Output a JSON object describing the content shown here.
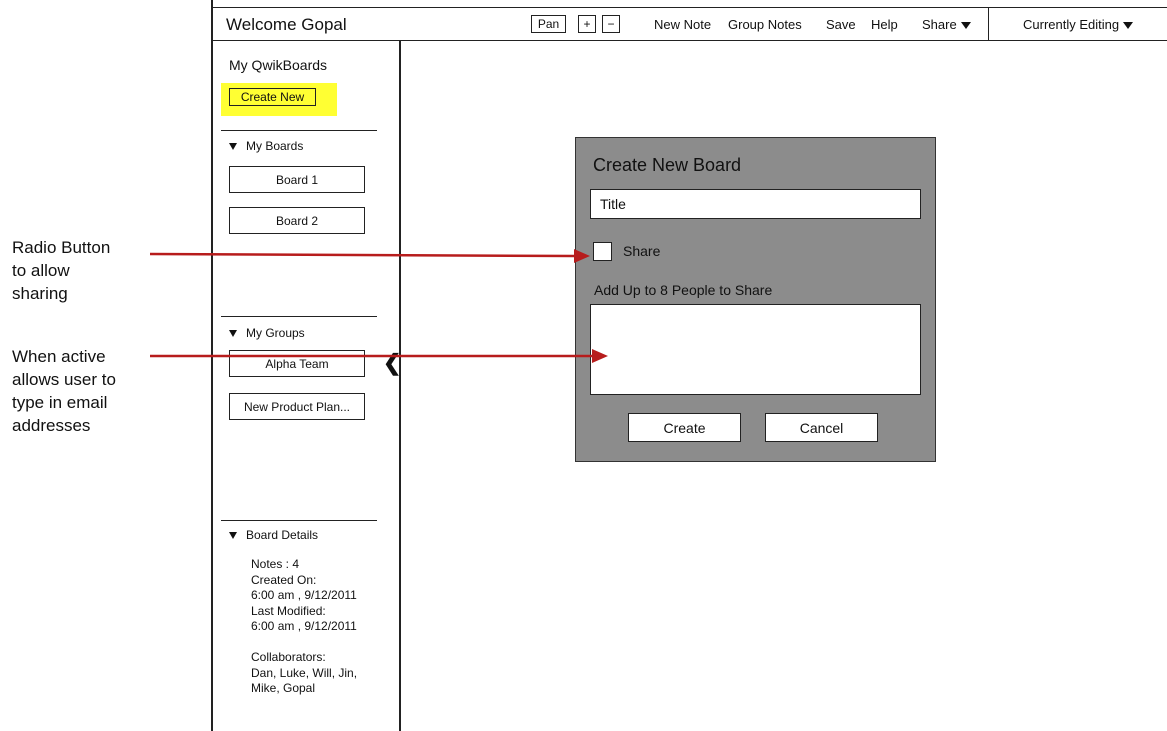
{
  "header": {
    "welcome": "Welcome Gopal",
    "pan_label": "Pan",
    "zoom_in_label": "+",
    "zoom_out_label": "−",
    "menu": {
      "new_note": "New Note",
      "group_notes": "Group Notes",
      "save": "Save",
      "help": "Help",
      "share": "Share",
      "currently_editing": "Currently Editing"
    }
  },
  "sidebar": {
    "title": "My QwikBoards",
    "create_new": "Create New",
    "my_boards": {
      "heading": "My Boards",
      "items": [
        "Board 1",
        "Board 2"
      ]
    },
    "my_groups": {
      "heading": "My Groups",
      "items": [
        "Alpha Team",
        "New Product Plan..."
      ]
    },
    "board_details": {
      "heading": "Board Details",
      "lines": [
        "Notes : 4",
        "Created On:",
        "6:00 am , 9/12/2011",
        "Last Modified:",
        "6:00 am , 9/12/2011",
        "",
        "Collaborators:",
        "Dan, Luke, Will, Jin,",
        "Mike, Gopal"
      ]
    },
    "collapse_glyph": "❮"
  },
  "dialog": {
    "title": "Create New Board",
    "title_field_value": "Title",
    "share_label": "Share",
    "share_checked": false,
    "people_label": "Add Up to 8 People to Share",
    "people_value": "",
    "create_button": "Create",
    "cancel_button": "Cancel",
    "background_color": "#8c8c8c"
  },
  "annotations": {
    "radio": [
      "Radio Button",
      "to allow",
      "sharing"
    ],
    "email": [
      "When active",
      "allows user to",
      "type in email",
      "addresses"
    ],
    "arrow_color": "#b71c1c",
    "highlight_color": "#ffff33"
  }
}
